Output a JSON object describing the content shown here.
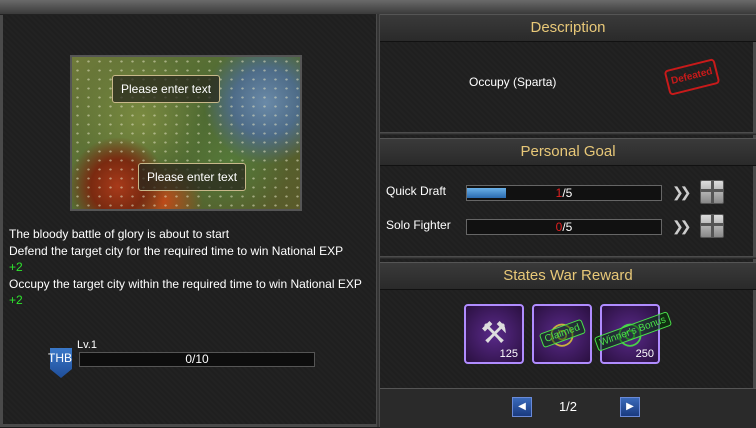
{
  "map": {
    "tooltip_top": "Please enter text",
    "tooltip_bottom": "Please enter text"
  },
  "left": {
    "lines": [
      "The bloody battle of glory is about to start",
      "Defend the target city for the required time to win National EXP",
      "+2",
      "Occupy the target city within the required time to win National EXP",
      "+2"
    ],
    "badge": "THB",
    "level": "Lv.1",
    "progress_text": "0/10",
    "progress_fraction": 0.0
  },
  "description": {
    "title": "Description",
    "target": "Occupy (Sparta)",
    "stamp": "Defeated"
  },
  "goals": {
    "title": "Personal Goal",
    "items": [
      {
        "label": "Quick Draft",
        "current": "1",
        "total": "/5",
        "fraction": 0.2
      },
      {
        "label": "Solo Fighter",
        "current": "0",
        "total": "/5",
        "fraction": 0.0
      }
    ]
  },
  "rewards": {
    "title": "States War Reward",
    "items": [
      {
        "icon": "hammer-icon",
        "count": "125",
        "stamp": ""
      },
      {
        "icon": "ring-icon",
        "count": "",
        "stamp": "Claimed"
      },
      {
        "icon": "ring-icon",
        "count": "250",
        "stamp": "Winner's Bonus"
      }
    ]
  },
  "pager": {
    "text": "1/2"
  }
}
